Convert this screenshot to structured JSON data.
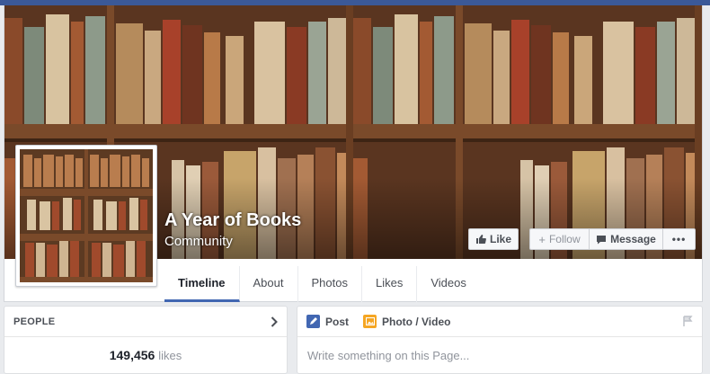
{
  "page": {
    "name": "A Year of Books",
    "category": "Community"
  },
  "actions": {
    "like": "Like",
    "follow": "Follow",
    "message": "Message",
    "more": "•••"
  },
  "nav": {
    "tabs": [
      "Timeline",
      "About",
      "Photos",
      "Likes",
      "Videos"
    ],
    "active": "Timeline"
  },
  "people": {
    "title": "PEOPLE",
    "likes_count": "149,456",
    "likes_unit": "likes"
  },
  "composer": {
    "post_tab": "Post",
    "photo_tab": "Photo / Video",
    "placeholder": "Write something on this Page..."
  },
  "colors": {
    "brand": "#3b5998",
    "active_tab_underline": "#4267b2",
    "post_icon": "#4267b2",
    "photo_icon": "#f5a623"
  }
}
